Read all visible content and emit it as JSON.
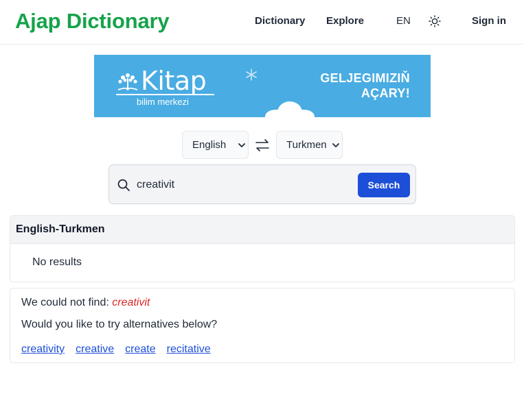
{
  "header": {
    "brand": "Ajap Dictionary",
    "nav": {
      "dictionary": "Dictionary",
      "explore": "Explore"
    },
    "language": "EN",
    "sign_in": "Sign in"
  },
  "banner": {
    "logo": "Kitap",
    "logo_sub": "bilim merkezi",
    "slogan_line1": "GELJEGIMIZIŇ",
    "slogan_line2": "AÇARY!"
  },
  "translator": {
    "from_language": "English",
    "to_language": "Turkmen"
  },
  "search": {
    "query": "creativit",
    "button": "Search"
  },
  "results": {
    "header": "English-Turkmen",
    "message": "No results"
  },
  "suggestions": {
    "not_found_label": "We could not find:",
    "not_found_term": "creativit",
    "prompt": "Would you like to try alternatives below?",
    "alternatives": [
      "creativity",
      "creative",
      "create",
      "recitative"
    ]
  }
}
